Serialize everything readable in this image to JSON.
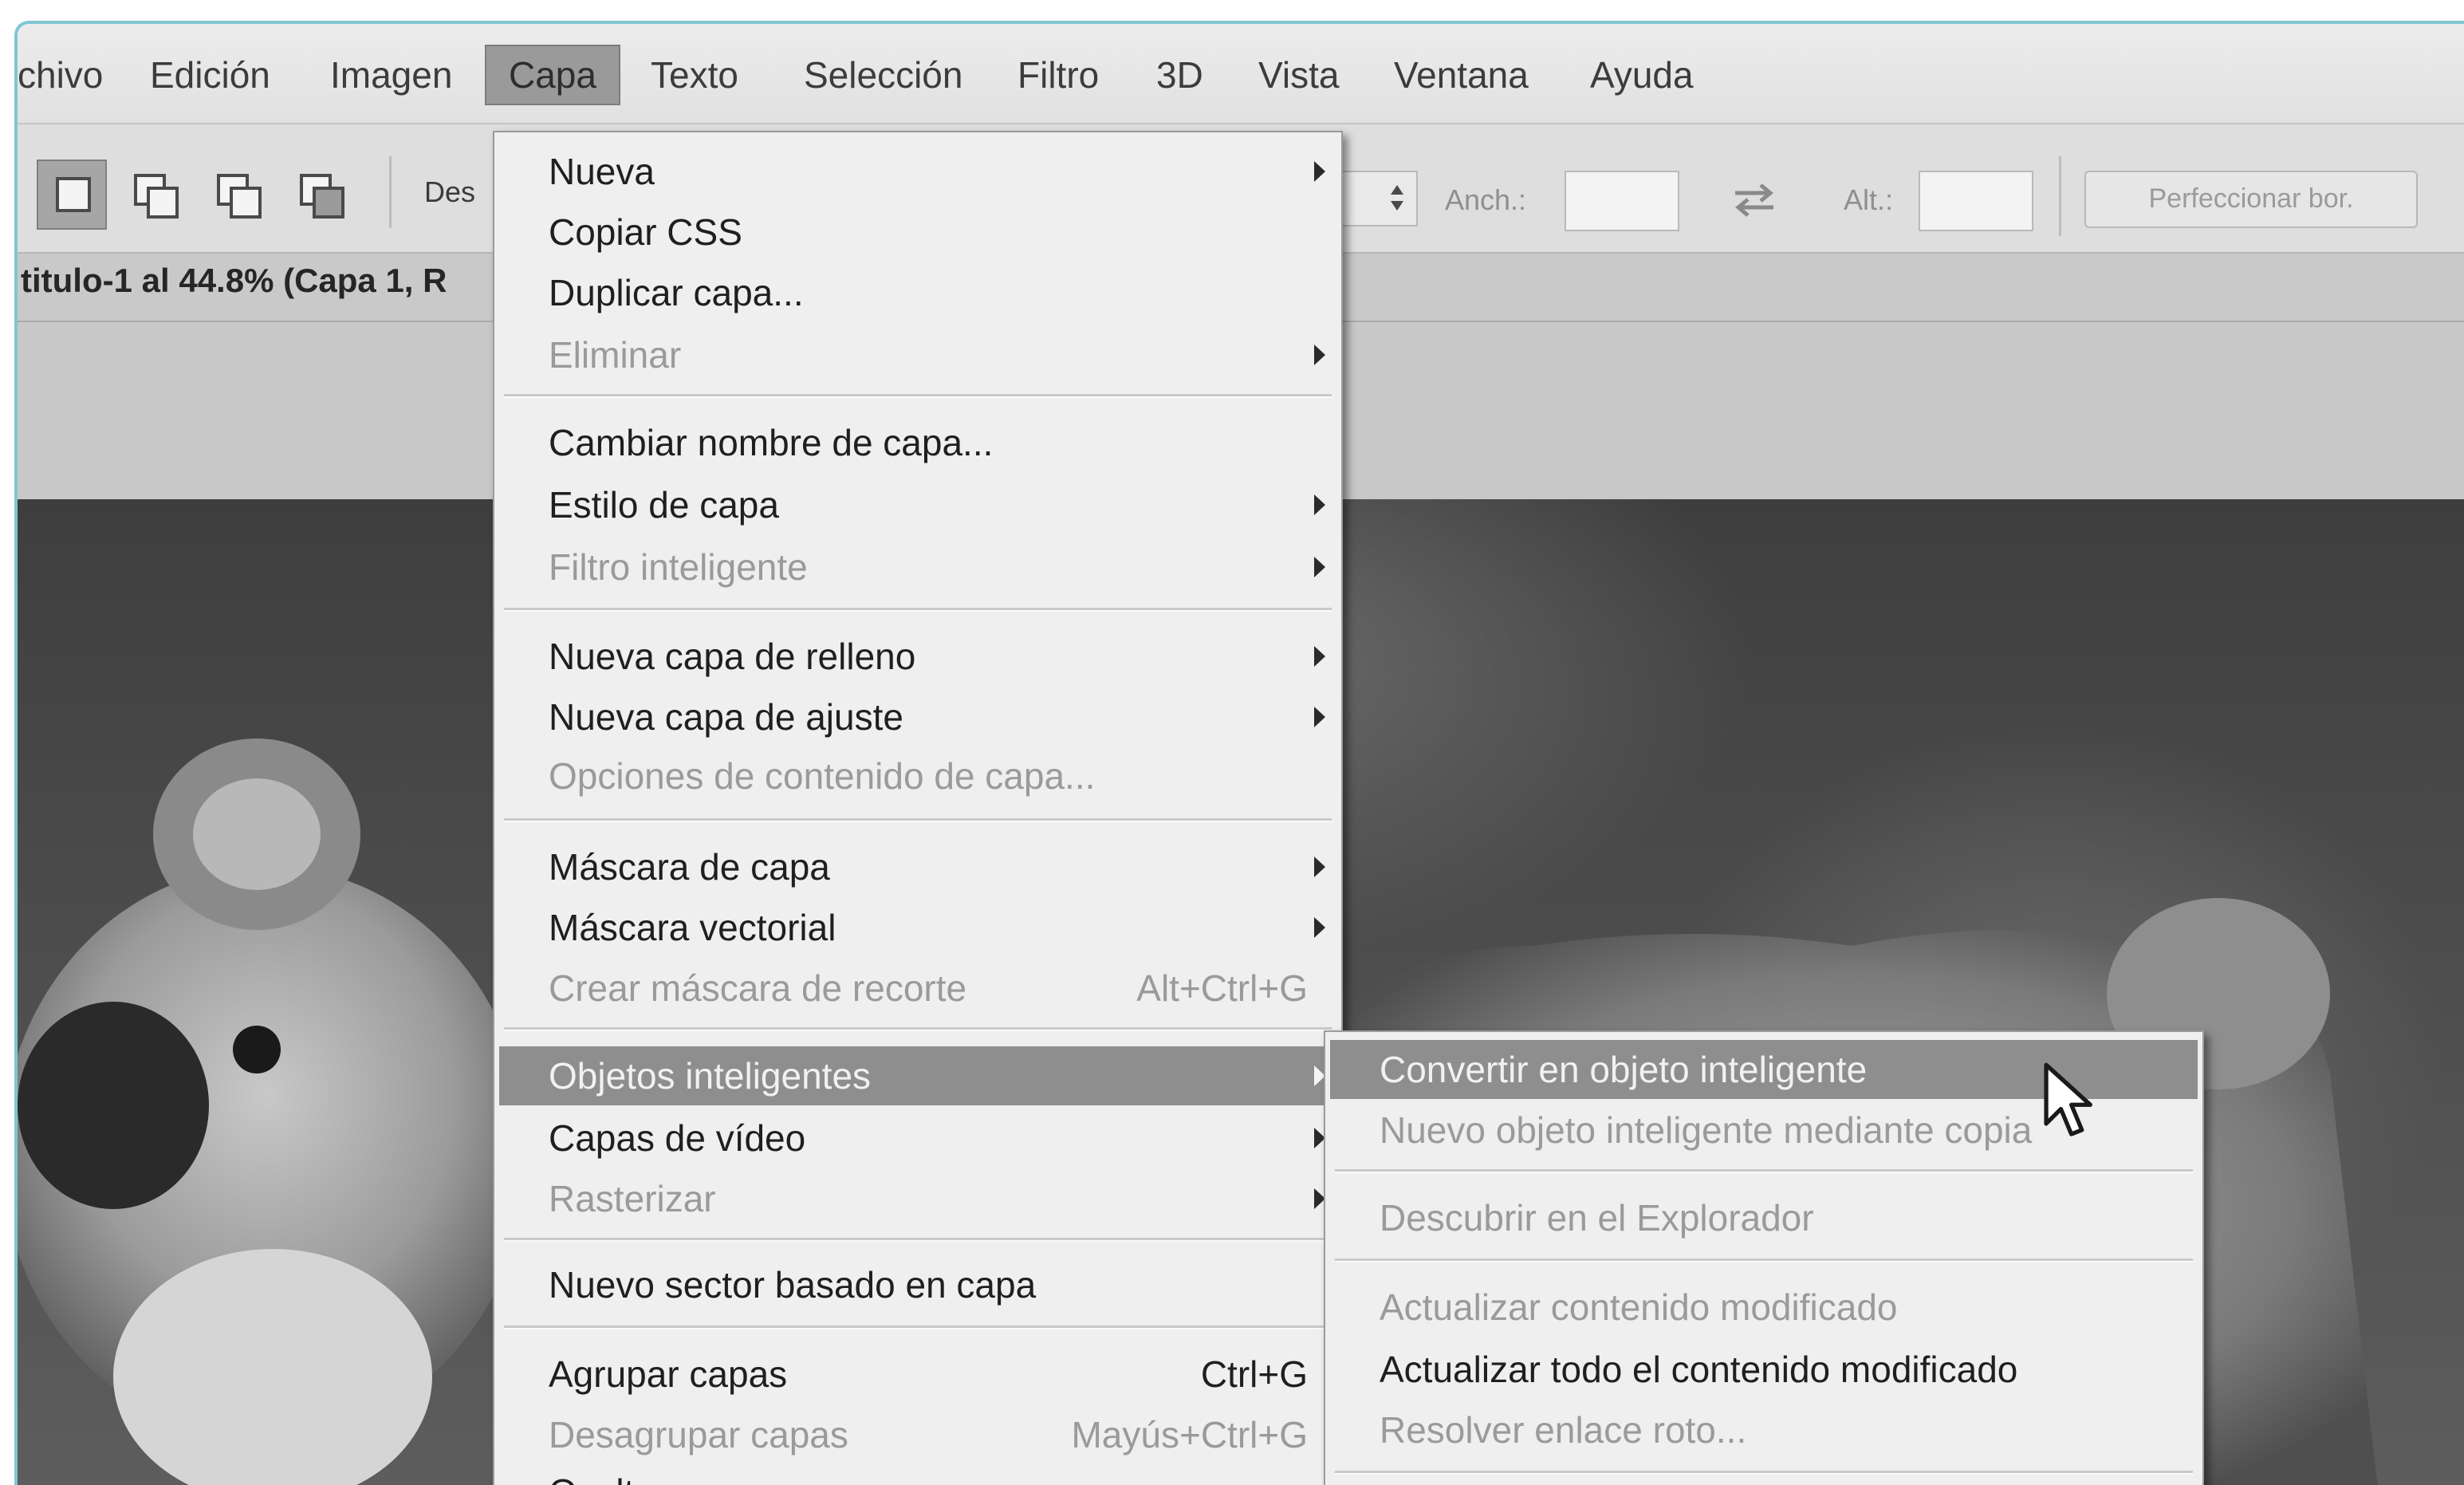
{
  "menubar": {
    "items": [
      "chivo",
      "Edición",
      "Imagen",
      "Capa",
      "Texto",
      "Selección",
      "Filtro",
      "3D",
      "Vista",
      "Ventana",
      "Ayuda"
    ],
    "active": "Capa"
  },
  "options_bar": {
    "style_label": "Des",
    "width_label": "Anch.:",
    "height_label": "Alt.:",
    "refine_button": "Perfeccionar bor."
  },
  "document": {
    "title": "titulo-1 al 44.8% (Capa 1, R"
  },
  "capa_menu": {
    "items": [
      {
        "label": "Nueva",
        "submenu": true
      },
      {
        "label": "Copiar CSS"
      },
      {
        "label": "Duplicar capa..."
      },
      {
        "label": "Eliminar",
        "disabled": true,
        "submenu": true
      },
      {
        "label": "Cambiar nombre de capa..."
      },
      {
        "label": "Estilo de capa",
        "submenu": true
      },
      {
        "label": "Filtro inteligente",
        "disabled": true,
        "submenu": true
      },
      {
        "label": "Nueva capa de relleno",
        "submenu": true
      },
      {
        "label": "Nueva capa de ajuste",
        "submenu": true
      },
      {
        "label": "Opciones de contenido de capa...",
        "disabled": true
      },
      {
        "label": "Máscara de capa",
        "submenu": true
      },
      {
        "label": "Máscara vectorial",
        "submenu": true
      },
      {
        "label": "Crear máscara de recorte",
        "shortcut": "Alt+Ctrl+G",
        "disabled": true
      },
      {
        "label": "Objetos inteligentes",
        "submenu": true,
        "highlighted": true
      },
      {
        "label": "Capas de vídeo",
        "submenu": true
      },
      {
        "label": "Rasterizar",
        "disabled": true,
        "submenu": true
      },
      {
        "label": "Nuevo sector basado en capa"
      },
      {
        "label": "Agrupar capas",
        "shortcut": "Ctrl+G"
      },
      {
        "label": "Desagrupar capas",
        "shortcut": "Mayús+Ctrl+G",
        "disabled": true
      },
      {
        "label": "Ocultar capas"
      }
    ]
  },
  "smart_objects_menu": {
    "items": [
      {
        "label": "Convertir en objeto inteligente",
        "highlighted": true
      },
      {
        "label": "Nuevo objeto inteligente mediante copia",
        "disabled": true
      },
      {
        "label": "Descubrir en el Explorador",
        "disabled": true
      },
      {
        "label": "Actualizar contenido modificado",
        "disabled": true
      },
      {
        "label": "Actualizar todo el contenido modificado"
      },
      {
        "label": "Resolver enlace roto...",
        "disabled": true
      }
    ]
  },
  "colors": {
    "highlight": "#8e8e8e",
    "menu_bg": "#efefef",
    "frame_accent": "#7fc6d3"
  }
}
